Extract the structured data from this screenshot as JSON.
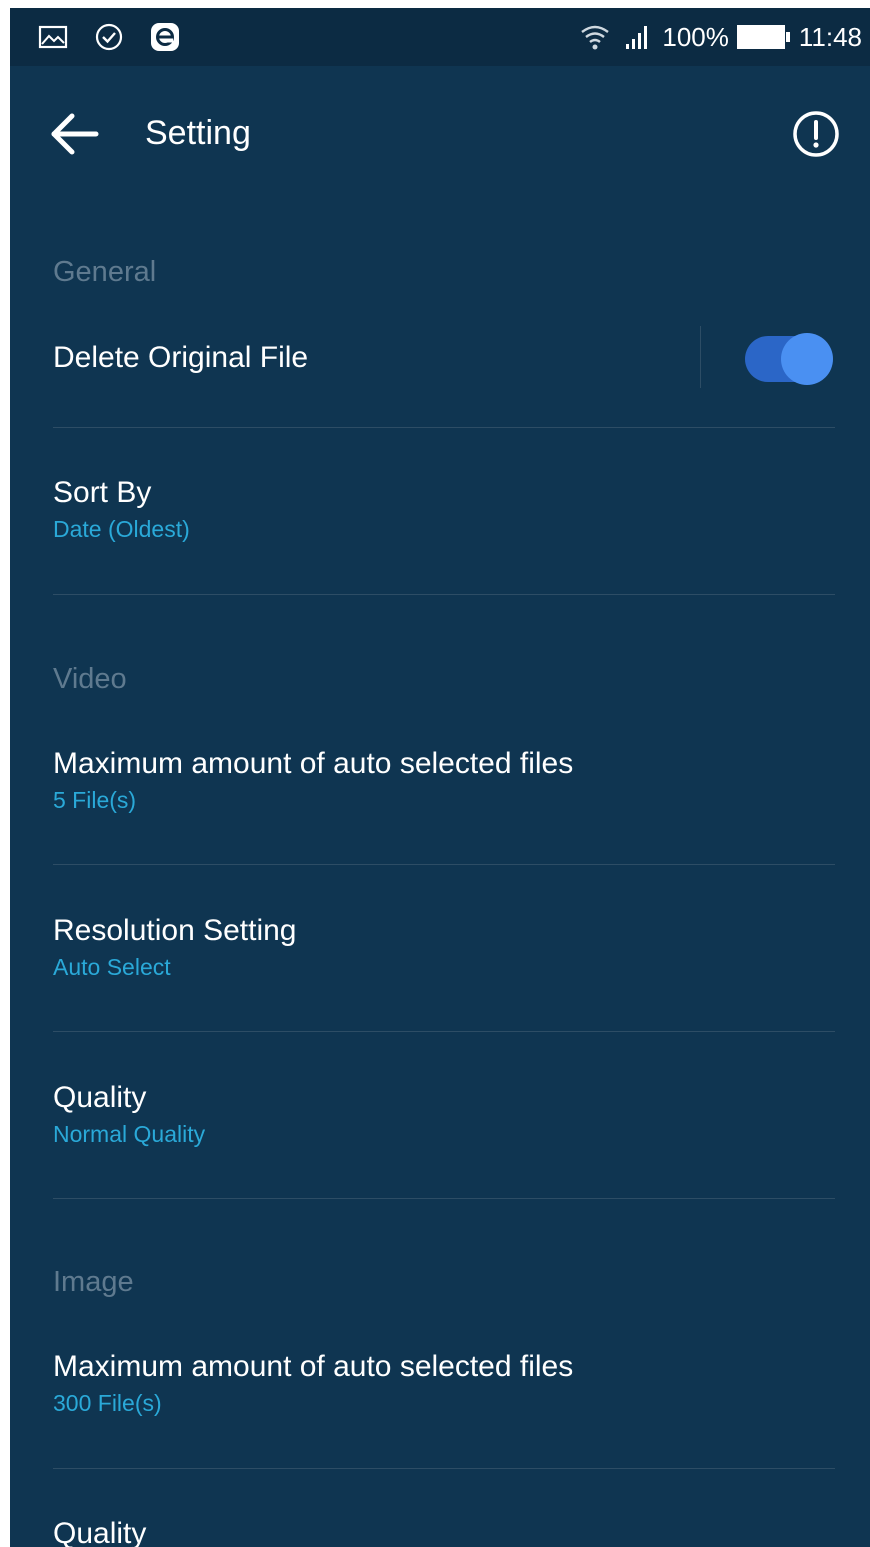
{
  "status_bar": {
    "icons": [
      "gallery-icon",
      "check-circle-icon",
      "e-app-icon",
      "wifi-icon",
      "signal-icon",
      "battery-icon"
    ],
    "battery": "100%",
    "time": "11:48"
  },
  "app_bar": {
    "title": "Setting",
    "back_icon": "arrow-left-icon",
    "info_icon": "info-circle-icon"
  },
  "sections": {
    "general": {
      "header": "General",
      "delete_original": {
        "title": "Delete Original File",
        "enabled": true
      },
      "sort_by": {
        "title": "Sort By",
        "value": "Date (Oldest)"
      }
    },
    "video": {
      "header": "Video",
      "max_files": {
        "title": "Maximum amount of auto selected files",
        "value": "5 File(s)"
      },
      "resolution": {
        "title": "Resolution Setting",
        "value": "Auto Select"
      },
      "quality": {
        "title": "Quality",
        "value": "Normal Quality"
      }
    },
    "image": {
      "header": "Image",
      "max_files": {
        "title": "Maximum amount of auto selected files",
        "value": "300 File(s)"
      },
      "quality": {
        "title": "Quality"
      }
    }
  },
  "colors": {
    "background": "#0f3551",
    "status_bar": "#0c2b43",
    "section_header": "#5f7a8f",
    "subtitle": "#2aa9d8",
    "toggle_on": "#4a90f2"
  }
}
